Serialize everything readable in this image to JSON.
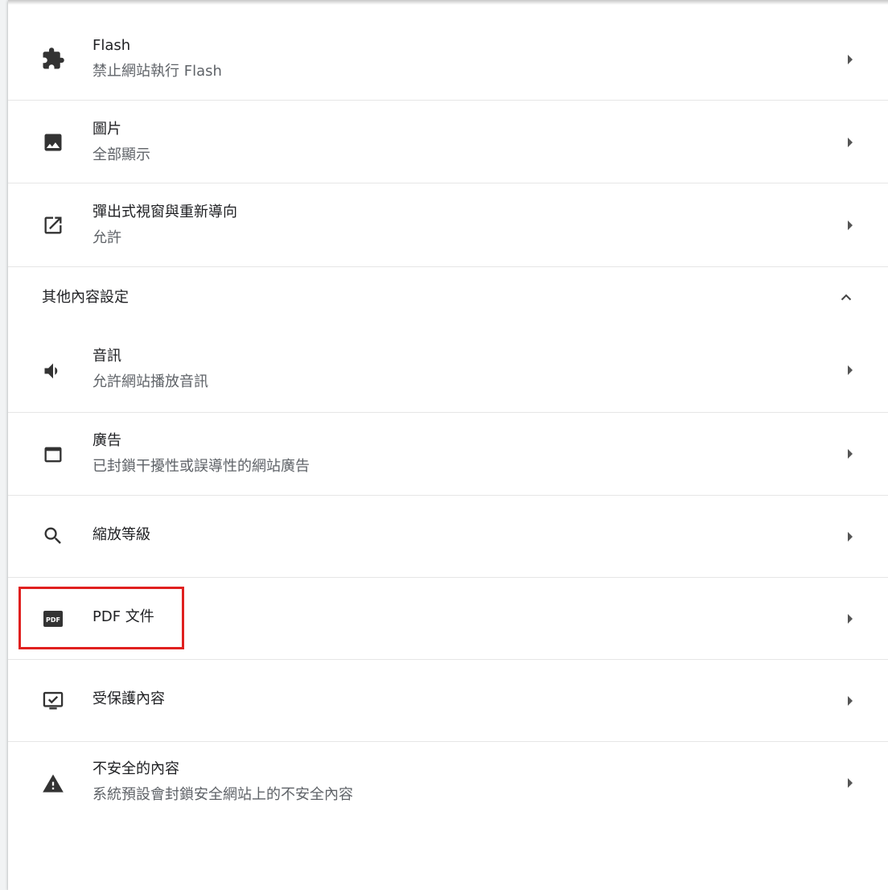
{
  "rows": [
    {
      "title": "Flash",
      "subtitle": "禁止網站執行 Flash",
      "icon": "puzzle-icon"
    },
    {
      "title": "圖片",
      "subtitle": "全部顯示",
      "icon": "image-icon"
    },
    {
      "title": "彈出式視窗與重新導向",
      "subtitle": "允許",
      "icon": "open-external-icon"
    }
  ],
  "section": {
    "title": "其他內容設定",
    "icon": "chevron-up-icon"
  },
  "more_rows": [
    {
      "title": "音訊",
      "subtitle": "允許網站播放音訊",
      "icon": "speaker-icon"
    },
    {
      "title": "廣告",
      "subtitle": "已封鎖干擾性或誤導性的網站廣告",
      "icon": "window-icon"
    },
    {
      "title": "縮放等級",
      "icon": "search-icon"
    },
    {
      "title": "PDF 文件",
      "icon": "pdf-icon",
      "pdf_badge": "PDF"
    },
    {
      "title": "受保護內容",
      "icon": "protected-content-icon"
    },
    {
      "title": "不安全的內容",
      "subtitle": "系統預設會封鎖安全網站上的不安全內容",
      "icon": "warning-icon"
    }
  ],
  "colors": {
    "text_primary": "#202124",
    "text_secondary": "#5f6368",
    "icon": "#333333",
    "divider": "#e6e6e6",
    "highlight": "#e0201f"
  }
}
